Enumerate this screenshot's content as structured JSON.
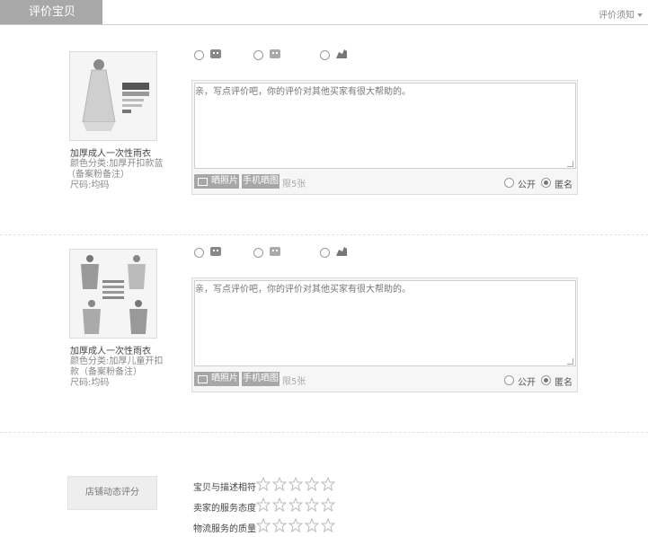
{
  "header": {
    "title": "评价宝贝",
    "notice": "评价须知"
  },
  "rating_options": [
    {
      "icon": "good-rating-icon",
      "checked": false
    },
    {
      "icon": "neutral-rating-icon",
      "checked": false
    },
    {
      "icon": "bad-rating-icon",
      "checked": false
    }
  ],
  "items": [
    {
      "name": "加厚成人一次性雨衣",
      "spec_lines": [
        "颜色分类:加厚开扣款蓝",
        "（备案粉备注）",
        "尺码:均码"
      ],
      "comment_placeholder": "亲，写点评价吧，你的评价对其他买家有很大帮助的。",
      "photo_button": "晒照片",
      "mobile_button": "手机晒图",
      "photo_limit": "限5张",
      "public_label": "公开",
      "anonymous_label": "匿名",
      "anonymous_checked": true
    },
    {
      "name": "加厚成人一次性雨衣",
      "spec_lines": [
        "颜色分类:加厚儿童开扣",
        "款（备案粉备注）",
        "尺码:均码"
      ],
      "comment_placeholder": "亲，写点评价吧，你的评价对其他买家有很大帮助的。",
      "photo_button": "晒照片",
      "mobile_button": "手机晒图",
      "photo_limit": "限5张",
      "public_label": "公开",
      "anonymous_label": "匿名",
      "anonymous_checked": true
    }
  ],
  "store_rating": {
    "button_label": "店铺动态评分",
    "criteria": [
      {
        "label": "宝贝与描述相符",
        "stars": 0,
        "max": 5
      },
      {
        "label": "卖家的服务态度",
        "stars": 0,
        "max": 5
      },
      {
        "label": "物流服务的质量",
        "stars": 0,
        "max": 5
      }
    ]
  },
  "colors": {
    "header_bg": "#a8a8a8",
    "button_bg": "#a7a7a7",
    "border": "#dddddd"
  }
}
